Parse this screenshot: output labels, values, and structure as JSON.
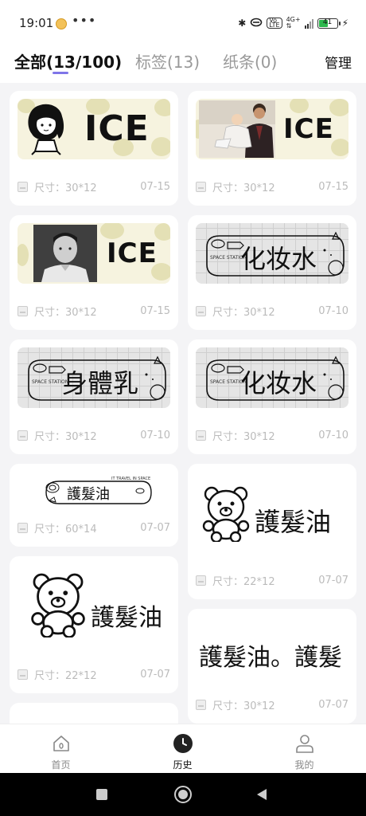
{
  "status_bar": {
    "time": "19:01",
    "dots": "•••",
    "bluetooth": "✱",
    "volte_top": "Vo",
    "volte_bottom": "LTE",
    "network_top": "4G+",
    "network_bottom": "⇅",
    "battery": "41",
    "charging": "⚡"
  },
  "header": {
    "tabs": [
      {
        "label": "全部(13/100)",
        "active": true
      },
      {
        "label": "标签(13)",
        "active": false
      },
      {
        "label": "纸条(0)",
        "active": false
      }
    ],
    "manage_label": "管理"
  },
  "cards": [
    {
      "kind": "ice-girl",
      "label_text": "ICE",
      "size": "尺寸：30*12",
      "date": "07-15"
    },
    {
      "kind": "ice-photo-family",
      "label_text": "ICE",
      "size": "尺寸：30*12",
      "date": "07-15"
    },
    {
      "kind": "ice-photo-man",
      "label_text": "ICE",
      "size": "尺寸：30*12",
      "date": "07-15"
    },
    {
      "kind": "space",
      "label_text": "化妆水",
      "small_text": "SPACE STATION",
      "size": "尺寸：30*12",
      "date": "07-10"
    },
    {
      "kind": "space",
      "label_text": "身體乳",
      "small_text": "SPACE STATION",
      "size": "尺寸：30*12",
      "date": "07-10"
    },
    {
      "kind": "space",
      "label_text": "化妆水",
      "small_text": "SPACE STATION",
      "size": "尺寸：30*12",
      "date": "07-10"
    },
    {
      "kind": "hair-small",
      "label_text": "護髮油",
      "small_text": "IT TRAVEL IN SPACE",
      "size": "尺寸：60*14",
      "date": "07-07"
    },
    {
      "kind": "bear",
      "label_text": "護髮油",
      "size": "尺寸：22*12",
      "date": "07-07"
    },
    {
      "kind": "bear",
      "label_text": "護髮油",
      "size": "尺寸：22*12",
      "date": "07-07"
    },
    {
      "kind": "text-only",
      "label_text": "護髮油。護髮",
      "size": "尺寸：30*12",
      "date": "07-07"
    }
  ],
  "bottom_nav": [
    {
      "label": "首页",
      "icon": "home-icon",
      "active": false
    },
    {
      "label": "历史",
      "icon": "clock-icon",
      "active": true
    },
    {
      "label": "我的",
      "icon": "person-icon",
      "active": false
    }
  ],
  "system_nav": [
    "square-icon",
    "circle-icon",
    "back-triangle-icon"
  ]
}
